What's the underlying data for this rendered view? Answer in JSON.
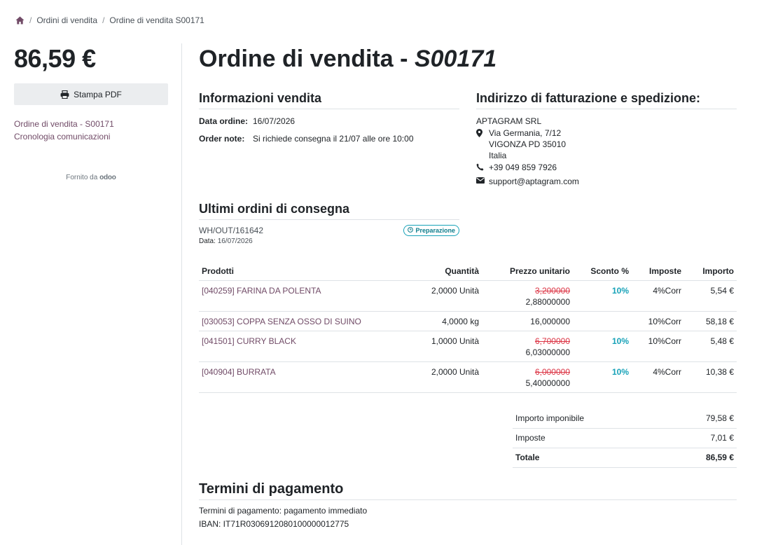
{
  "breadcrumb": {
    "home_icon": "home-icon",
    "items": [
      "Ordini di vendita",
      "Ordine di vendita S00171"
    ]
  },
  "sidebar": {
    "total": "86,59 €",
    "pdf_button": "Stampa PDF",
    "links": [
      "Ordine di vendita - S00171",
      "Cronologia comunicazioni"
    ],
    "powered_by": "Fornito da",
    "powered_brand": "odoo"
  },
  "order": {
    "title_prefix": "Ordine di vendita - ",
    "code": "S00171"
  },
  "info": {
    "heading": "Informazioni vendita",
    "date_label": "Data ordine:",
    "date_value": "16/07/2026",
    "note_label": "Order note:",
    "note_value": "Si richiede consegna il 21/07 alle ore 10:00"
  },
  "address": {
    "heading": "Indirizzo di fatturazione e spedizione:",
    "company": "APTAGRAM SRL",
    "street": "Via Germania, 7/12",
    "city": "VIGONZA PD 35010",
    "country": "Italia",
    "phone": "+39 049 859 7926",
    "email": "support@aptagram.com"
  },
  "delivery": {
    "heading": "Ultimi ordini di consegna",
    "ref": "WH/OUT/161642",
    "status": "Preparazione",
    "date_label": "Data:",
    "date_value": "16/07/2026"
  },
  "lines": {
    "headers": {
      "product": "Prodotti",
      "qty": "Quantità",
      "price": "Prezzo unitario",
      "discount": "Sconto %",
      "taxes": "Imposte",
      "amount": "Importo"
    },
    "rows": [
      {
        "product": "[040259] FARINA DA POLENTA",
        "qty": "2,0000 Unità",
        "old_price": "3,200000",
        "price": "2,88000000",
        "discount": "10%",
        "taxes": "4%Corr",
        "amount": "5,54 €"
      },
      {
        "product": "[030053] COPPA SENZA OSSO DI SUINO",
        "qty": "4,0000 kg",
        "old_price": "",
        "price": "16,000000",
        "discount": "",
        "taxes": "10%Corr",
        "amount": "58,18 €"
      },
      {
        "product": "[041501] CURRY BLACK",
        "qty": "1,0000 Unità",
        "old_price": "6,700000",
        "price": "6,03000000",
        "discount": "10%",
        "taxes": "10%Corr",
        "amount": "5,48 €"
      },
      {
        "product": "[040904] BURRATA",
        "qty": "2,0000 Unità",
        "old_price": "6,000000",
        "price": "5,40000000",
        "discount": "10%",
        "taxes": "4%Corr",
        "amount": "10,38 €"
      }
    ]
  },
  "totals": {
    "untaxed_label": "Importo imponibile",
    "untaxed_value": "79,58 €",
    "taxes_label": "Imposte",
    "taxes_value": "7,01 €",
    "total_label": "Totale",
    "total_value": "86,59 €"
  },
  "payment": {
    "heading": "Termini di pagamento",
    "line1": "Termini di pagamento: pagamento immediato",
    "line2": "IBAN: IT71R0306912080100000012775"
  },
  "colors": {
    "link": "#714b67",
    "discount": "#17a2b8",
    "strike": "#dc3545"
  }
}
